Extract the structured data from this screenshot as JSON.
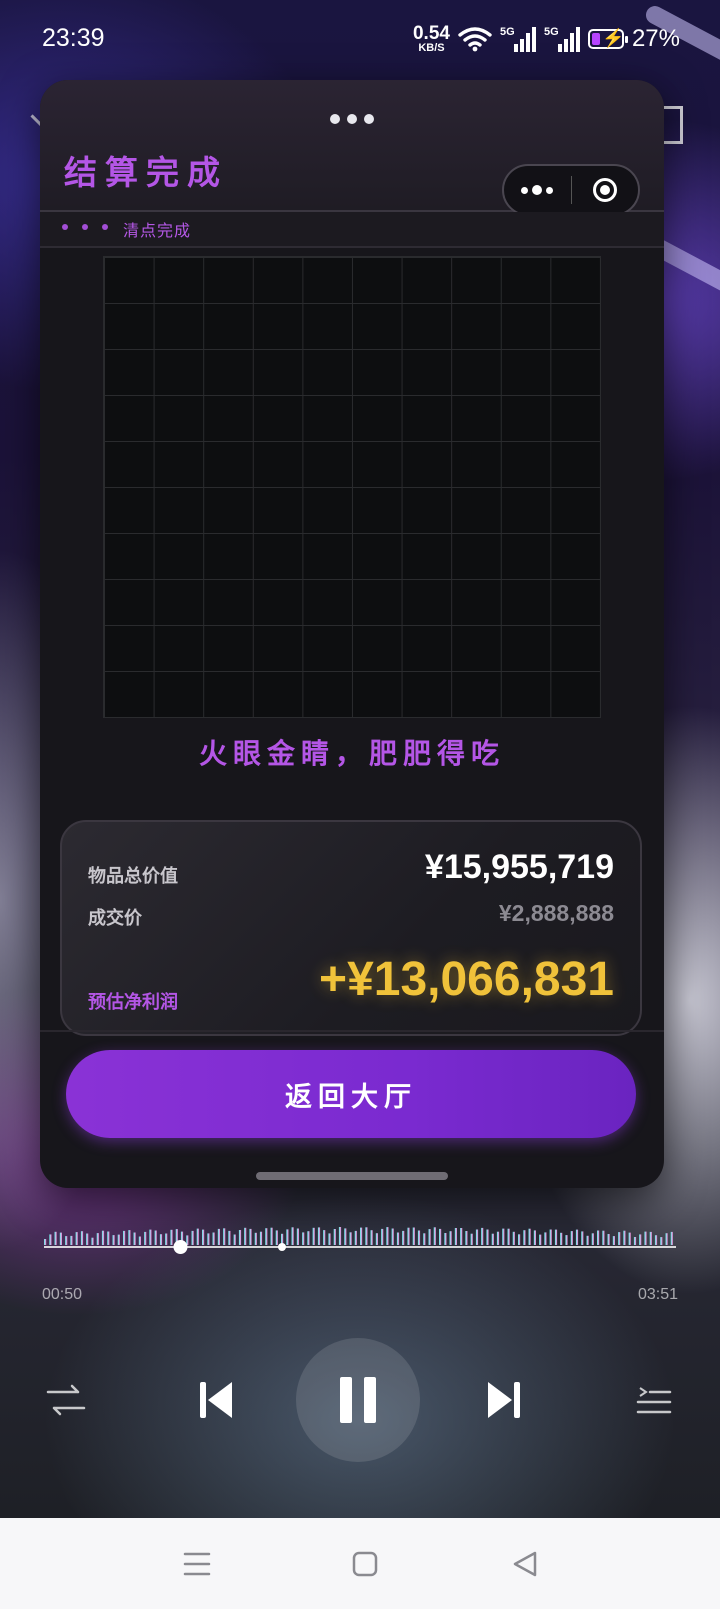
{
  "status_bar": {
    "time": "23:39",
    "net_speed_value": "0.54",
    "net_speed_unit": "KB/S",
    "signal_tag_1": "5G",
    "signal_tag_2": "5G",
    "battery_percent": "27%",
    "battery_level": 0.27
  },
  "miniprogram": {
    "title": "结算完成",
    "sub_label": "清点完成",
    "slogan": "火眼金睛，肥肥得吃",
    "grid": {
      "columns": 10,
      "rows": 10
    },
    "summary": {
      "total_value_label": "物品总价值",
      "total_value": "¥15,955,719",
      "deal_price_label": "成交价",
      "deal_price": "¥2,888,888",
      "profit_label": "预估净利润",
      "profit": "+¥13,066,831"
    },
    "back_button_label": "返回大厅",
    "colors": {
      "accent_purple": "#b456e6",
      "profit_gold": "#f0c23a",
      "button_purple": "#8a32d6"
    }
  },
  "player": {
    "current_time": "00:50",
    "total_time": "03:51",
    "progress": 0.216,
    "icons": [
      "shuffle-icon",
      "previous-icon",
      "pause-icon",
      "next-icon",
      "playlist-icon"
    ]
  },
  "navbar": {
    "icons": [
      "menu-icon",
      "home-icon",
      "back-icon"
    ]
  }
}
